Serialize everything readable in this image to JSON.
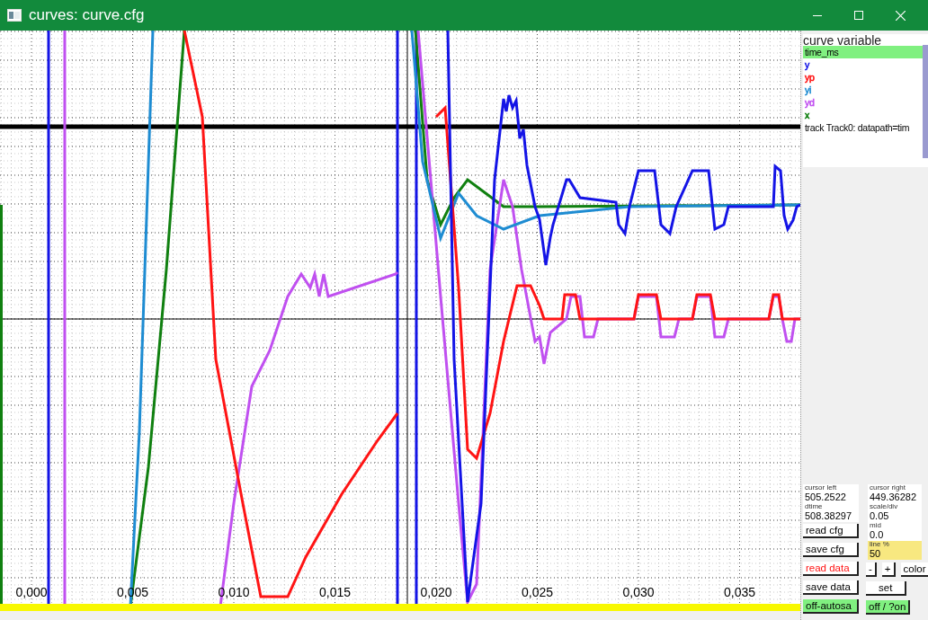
{
  "window": {
    "title": "curves: curve.cfg"
  },
  "plot": {
    "x_tick_labels": [
      "0,000",
      "0,005",
      "0,010",
      "0,015",
      "0,020",
      "0,025",
      "0,030",
      "0,035"
    ]
  },
  "variables": {
    "header": "curve variable",
    "items": [
      {
        "label": "time_ms",
        "selected": true
      },
      {
        "label": "y",
        "selected": false,
        "color": "#1414e6"
      },
      {
        "label": "yp",
        "selected": false,
        "color": "#ff1414"
      },
      {
        "label": "yi",
        "selected": false,
        "color": "#1e8cd2"
      },
      {
        "label": "yd",
        "selected": false,
        "color": "#c050f0"
      },
      {
        "label": "x",
        "selected": false,
        "color": "#108010"
      },
      {
        "label": "track Track0: datapath=tim",
        "selected": false
      }
    ]
  },
  "fields": [
    {
      "label": "cursor left",
      "value": "505.2522",
      "highlighted": false
    },
    {
      "label": "cursor right",
      "value": "449.36282",
      "highlighted": false
    },
    {
      "label": "dtime",
      "value": "508.38297",
      "highlighted": false
    },
    {
      "label": "scale/div",
      "value": "0.05",
      "highlighted": false
    },
    {
      "label": "mid",
      "value": "0.0",
      "highlighted": false
    },
    {
      "label": "line %",
      "value": "50",
      "highlighted": true
    }
  ],
  "buttons": [
    {
      "label": "read cfg",
      "kind": "push"
    },
    {
      "label": "save cfg",
      "kind": "push"
    },
    {
      "label": "read data",
      "kind": "alert"
    },
    {
      "label": "-",
      "kind": "push"
    },
    {
      "label": "+",
      "kind": "push"
    },
    {
      "label": "color",
      "kind": "push"
    },
    {
      "label": "save data",
      "kind": "push"
    },
    {
      "label": "set",
      "kind": "push"
    },
    {
      "label": "off-autosa",
      "kind": "toggle"
    },
    {
      "label": "off / ?on",
      "kind": "toggle"
    }
  ]
}
